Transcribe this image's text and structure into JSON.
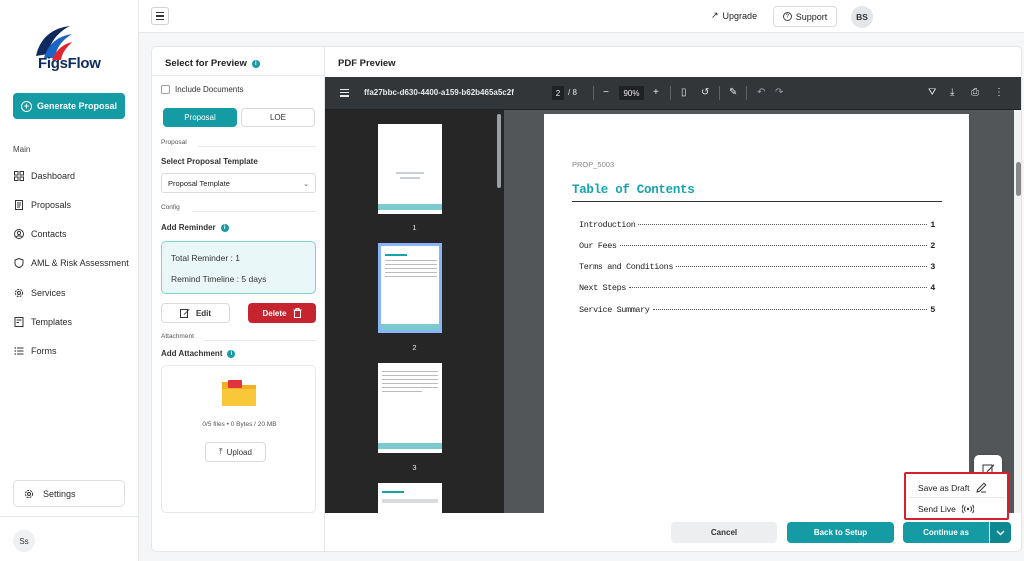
{
  "brand": {
    "name": "FigsFlow",
    "accent": "#159ba3",
    "danger": "#c6252f"
  },
  "sidebar": {
    "generate_label": "Generate Proposal",
    "section_main": "Main",
    "items": [
      {
        "label": "Dashboard",
        "icon": "grid-icon"
      },
      {
        "label": "Proposals",
        "icon": "document-icon"
      },
      {
        "label": "Contacts",
        "icon": "contact-icon"
      },
      {
        "label": "AML & Risk Assessment",
        "icon": "shield-icon"
      },
      {
        "label": "Services",
        "icon": "gear-icon"
      },
      {
        "label": "Templates",
        "icon": "template-icon"
      },
      {
        "label": "Forms",
        "icon": "list-icon"
      }
    ],
    "settings_label": "Settings",
    "user_initials": "Ss"
  },
  "topbar": {
    "upgrade_label": "Upgrade",
    "support_label": "Support",
    "user_initials": "BS"
  },
  "left_panel": {
    "title": "Select for Preview",
    "include_documents": "Include Documents",
    "tabs": [
      "Proposal",
      "LOE"
    ],
    "section_proposal": "Proposal",
    "template_label": "Select Proposal Template",
    "template_value": "Proposal Template",
    "section_config": "Config",
    "reminder_label": "Add Reminder",
    "total_reminder": "Total Reminder :  1",
    "remind_timeline": "Remind Timeline :  5  days",
    "edit_label": "Edit",
    "delete_label": "Delete",
    "section_attachment": "Attachment",
    "attachment_label": "Add Attachment",
    "upload_stats": "0/5 files • 0 Bytes / 20 MB",
    "upload_label": "Upload"
  },
  "pdf": {
    "title": "PDF Preview",
    "file_name": "ffa27bbc-d630-4400-a159-b62b465a5c2f",
    "page_current": "2",
    "page_total": "/  8",
    "zoom": "90%",
    "thumb_numbers": [
      "1",
      "2",
      "3"
    ],
    "page_id": "PROP_5003",
    "toc_heading": "Table of Contents",
    "toc": [
      {
        "label": "Introduction",
        "page": "1"
      },
      {
        "label": "Our Fees",
        "page": "2"
      },
      {
        "label": "Terms and Conditions",
        "page": "3"
      },
      {
        "label": "Next Steps",
        "page": "4"
      },
      {
        "label": "Service Summary",
        "page": "5"
      }
    ]
  },
  "dropdown": {
    "save_draft": "Save as Draft",
    "send_live": "Send Live"
  },
  "footer": {
    "cancel": "Cancel",
    "back": "Back to Setup",
    "continue": "Continue as"
  }
}
